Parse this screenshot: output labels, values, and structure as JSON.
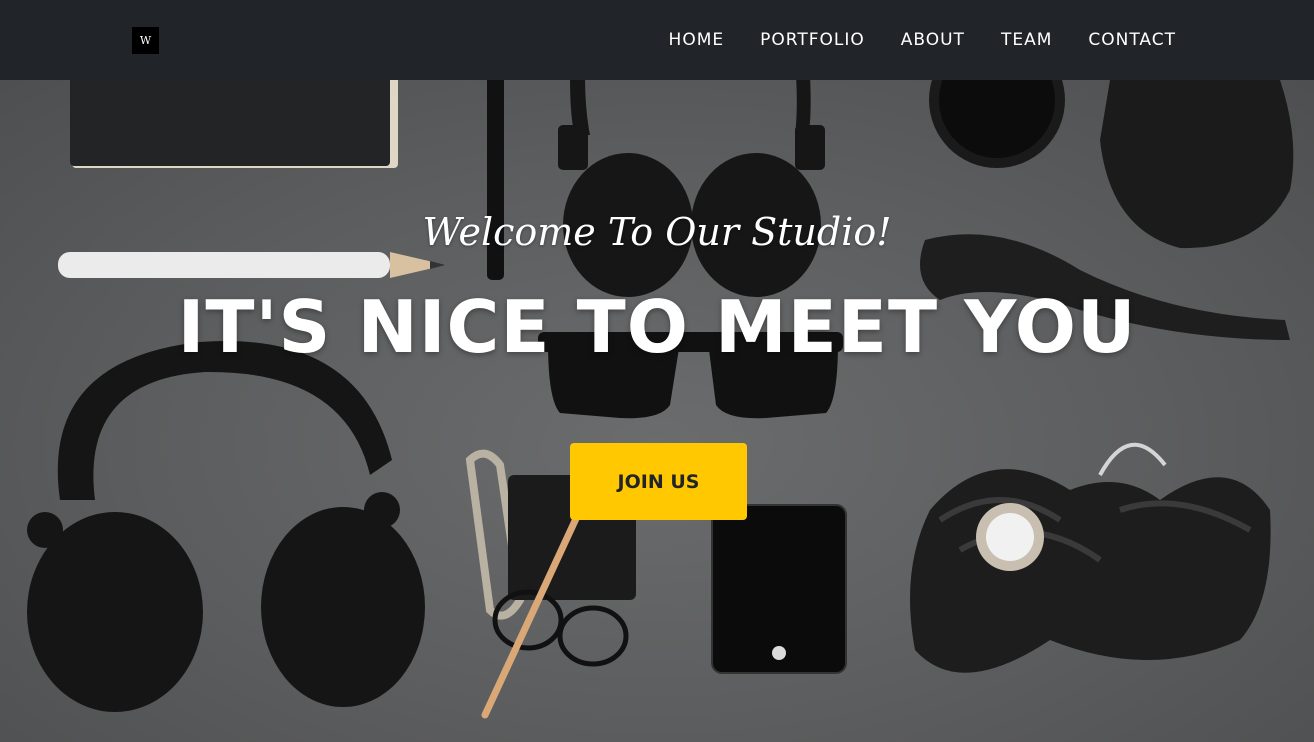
{
  "navbar": {
    "brand_letter": "W",
    "links": [
      {
        "label": "HOME"
      },
      {
        "label": "PORTFOLIO"
      },
      {
        "label": "ABOUT"
      },
      {
        "label": "TEAM"
      },
      {
        "label": "CONTACT"
      }
    ]
  },
  "hero": {
    "subheading": "Welcome To Our Studio!",
    "heading": "IT'S NICE TO MEET YOU",
    "cta_label": "JOIN US"
  },
  "colors": {
    "nav_background": "#212529",
    "accent": "#ffc800",
    "hero_background": "#5f6061"
  }
}
